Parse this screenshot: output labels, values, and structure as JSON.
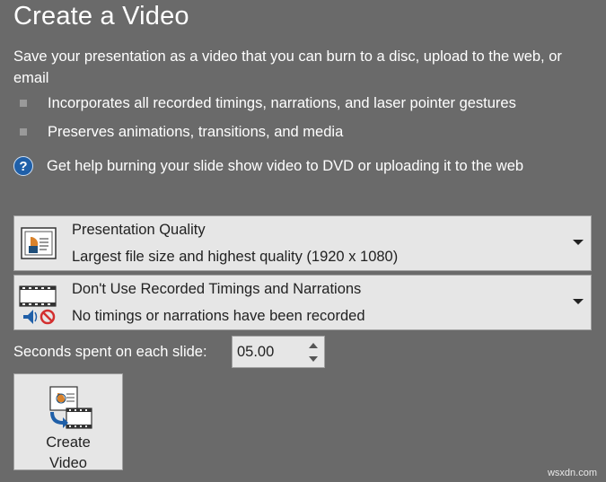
{
  "header": {
    "title": "Create a Video",
    "description": "Save your presentation as a video that you can burn to a disc, upload to the web, or email"
  },
  "bullets": [
    "Incorporates all recorded timings, narrations, and laser pointer gestures",
    "Preserves animations, transitions, and media"
  ],
  "help": {
    "icon": "help-question-icon",
    "text": "Get help burning your slide show video to DVD or uploading it to the web"
  },
  "quality_dropdown": {
    "icon": "presentation-quality-icon",
    "title": "Presentation Quality",
    "subtitle": "Largest file size and highest quality (1920 x 1080)"
  },
  "timings_dropdown": {
    "icon": "no-narration-film-icon",
    "title": "Don't Use Recorded Timings and Narrations",
    "subtitle": "No timings or narrations have been recorded"
  },
  "seconds": {
    "label": "Seconds spent on each slide:",
    "value": "05.00"
  },
  "create_button": {
    "icon": "create-video-icon",
    "line1": "Create",
    "line2": "Video"
  },
  "watermark": "wsxdn.com",
  "colors": {
    "background": "#6a6a6a",
    "control_bg": "#e6e6e6",
    "help_icon": "#1f5fa8",
    "no_sign": "#d32f2f"
  }
}
